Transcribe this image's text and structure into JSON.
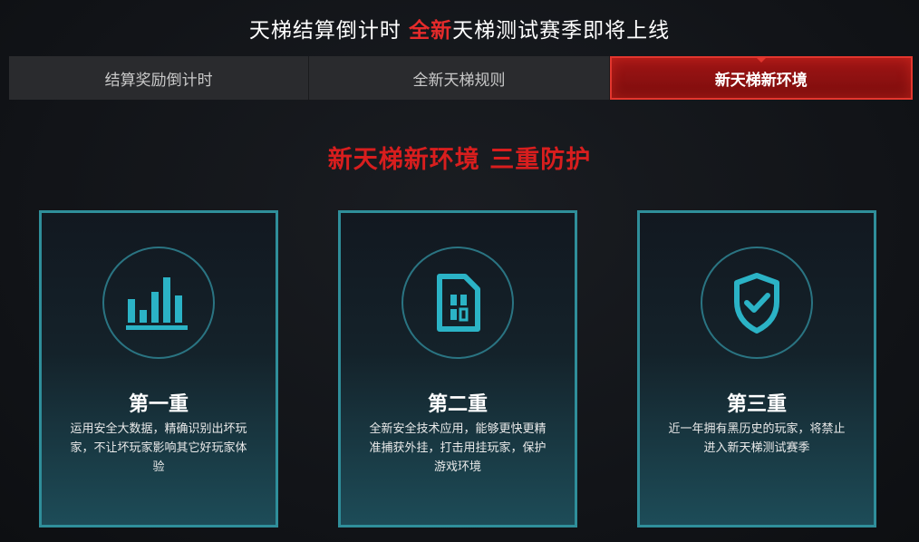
{
  "headline": {
    "part1": "天梯结算倒计时",
    "highlight": "全新",
    "part2": "天梯测试赛季即将上线"
  },
  "tabs": [
    {
      "label": "结算奖励倒计时",
      "active": false
    },
    {
      "label": "全新天梯规则",
      "active": false
    },
    {
      "label": "新天梯新环境",
      "active": true
    }
  ],
  "section_title": "新天梯新环境 三重防护",
  "cards": [
    {
      "icon": "bar-chart-icon",
      "title": "第一重",
      "desc": "运用安全大数据，精确识别出坏玩家，不让坏玩家影响其它好玩家体验"
    },
    {
      "icon": "sim-card-icon",
      "title": "第二重",
      "desc": "全新安全技术应用，能够更快更精准捕获外挂，打击用挂玩家，保护游戏环境"
    },
    {
      "icon": "shield-check-icon",
      "title": "第三重",
      "desc": "近一年拥有黑历史的玩家，将禁止进入新天梯测试赛季"
    }
  ],
  "colors": {
    "accent_red": "#e52b2b",
    "active_tab": "#8c1010",
    "card_border": "#2f8e9a",
    "icon": "#2bb3c6"
  }
}
